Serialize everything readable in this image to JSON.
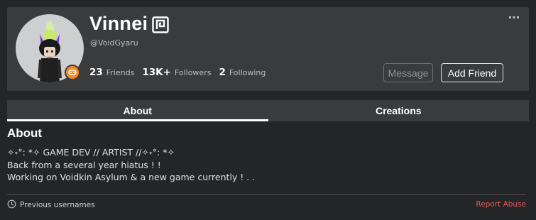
{
  "profile": {
    "display_name": "Vinnei",
    "username": "@VoidGyaru",
    "avatar_icon": "avatar-headshot",
    "premium_icon": "premium-icon",
    "presence_icon": "playing-presence-icon",
    "stats": [
      {
        "value": "23",
        "label": "Friends"
      },
      {
        "value": "13K+",
        "label": "Followers"
      },
      {
        "value": "2",
        "label": "Following"
      }
    ],
    "more_icon": "more-options-icon"
  },
  "actions": {
    "message_label": "Message",
    "add_friend_label": "Add Friend"
  },
  "tabs": [
    {
      "label": "About",
      "active": true
    },
    {
      "label": "Creations",
      "active": false
    }
  ],
  "about": {
    "heading": "About",
    "lines": [
      "✧˖°: *✧ GAME DEV // ARTIST //✧˖°: *✧",
      "Back from a several year hiatus ! !",
      "Working on Voidkin Asylum & a new game currently ! . ."
    ]
  },
  "footer": {
    "previous_usernames_label": "Previous usernames",
    "report_abuse_label": "Report Abuse"
  },
  "colors": {
    "page_bg": "#232527",
    "card_bg": "#393b3d",
    "report_red": "#e05b5b",
    "presence_orange": "#f68c1e"
  }
}
